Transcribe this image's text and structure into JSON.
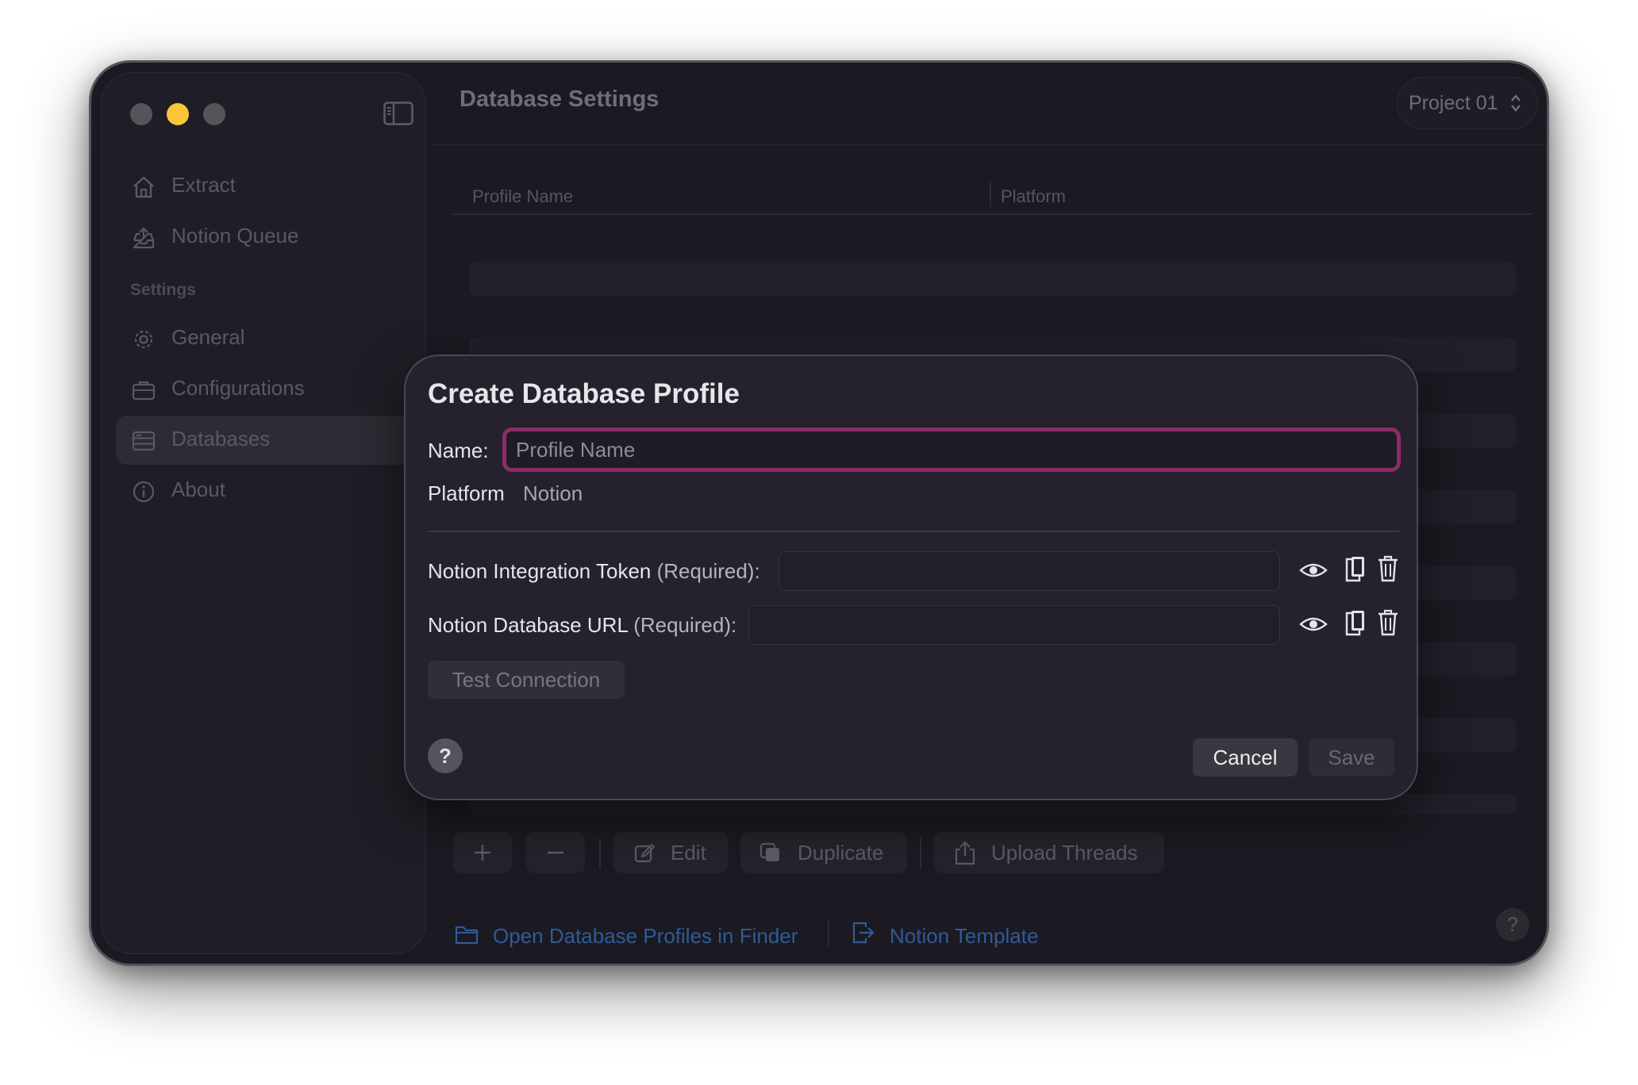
{
  "sidebar": {
    "items": [
      {
        "label": "Extract",
        "icon": "house-icon"
      },
      {
        "label": "Notion Queue",
        "icon": "tray-upload-icon"
      }
    ],
    "section_header": "Settings",
    "settings_items": [
      {
        "label": "General",
        "icon": "gear-icon"
      },
      {
        "label": "Configurations",
        "icon": "briefcase-icon"
      },
      {
        "label": "Databases",
        "icon": "database-icon",
        "active": true
      },
      {
        "label": "About",
        "icon": "info-icon"
      }
    ]
  },
  "main": {
    "title": "Database Settings",
    "project_selector": "Project 01",
    "table": {
      "columns": [
        "Profile Name",
        "Platform"
      ]
    },
    "toolbar": {
      "edit_label": "Edit",
      "duplicate_label": "Duplicate",
      "upload_label": "Upload Threads"
    },
    "footer": {
      "open_finder_label": "Open Database Profiles in Finder",
      "template_label": "Notion Template",
      "help_label": "?"
    }
  },
  "dialog": {
    "title": "Create Database Profile",
    "name_label": "Name:",
    "name_placeholder": "Profile Name",
    "platform_label": "Platform",
    "platform_value": "Notion",
    "token_label": "Notion Integration Token",
    "url_label": "Notion Database URL",
    "required_suffix": "(Required):",
    "test_connection_label": "Test Connection",
    "help_label": "?",
    "cancel_label": "Cancel",
    "save_label": "Save"
  },
  "colors": {
    "accent_focus": "#8a2d66",
    "traffic_min": "#fac536",
    "link": "#2f5b95"
  }
}
